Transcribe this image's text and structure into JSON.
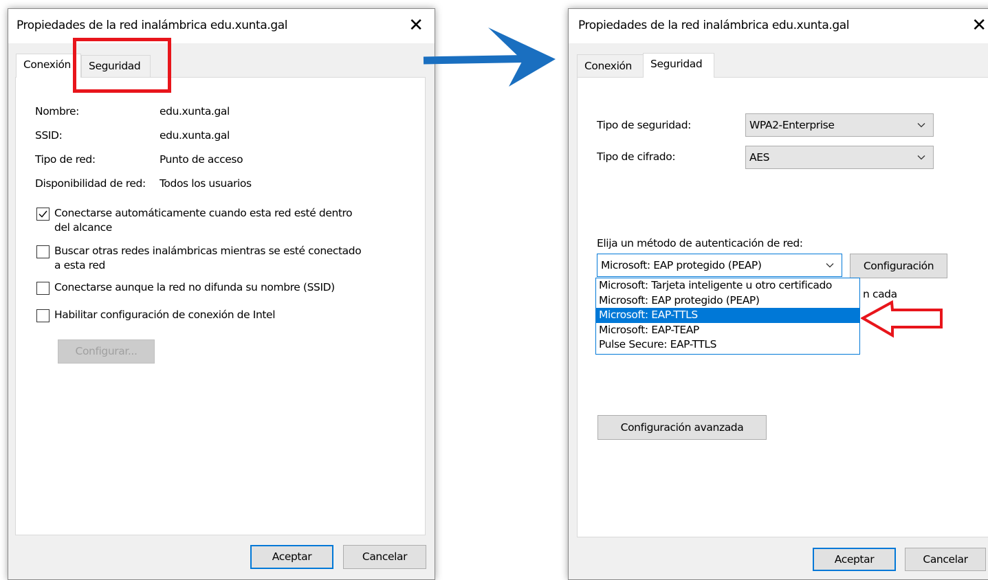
{
  "left_dialog": {
    "title": "Propiedades de la red inalámbrica edu.xunta.gal",
    "close": "✕",
    "tabs": [
      "Conexión",
      "Seguridad"
    ],
    "fields": [
      {
        "label": "Nombre:",
        "value": "edu.xunta.gal"
      },
      {
        "label": "SSID:",
        "value": "edu.xunta.gal"
      },
      {
        "label": "Tipo de red:",
        "value": "Punto de acceso"
      },
      {
        "label": "Disponibilidad de red:",
        "value": "Todos los usuarios"
      }
    ],
    "checkboxes": [
      {
        "line1": "Conectarse automáticamente cuando esta red esté dentro",
        "line2": "del alcance",
        "checked": true
      },
      {
        "line1": "Buscar otras redes inalámbricas mientras se esté conectado",
        "line2": "a esta red",
        "checked": false
      },
      {
        "line1": "Conectarse aunque la red no difunda su nombre (SSID)",
        "line2": "",
        "checked": false
      },
      {
        "line1": "Habilitar configuración de conexión de Intel",
        "line2": "",
        "checked": false
      }
    ],
    "configure_button": "Configurar...",
    "ok_button": "Aceptar",
    "cancel_button": "Cancelar"
  },
  "right_dialog": {
    "title": "Propiedades de la red inalámbrica edu.xunta.gal",
    "close": "✕",
    "tabs": [
      "Conexión",
      "Seguridad"
    ],
    "security_type_label": "Tipo de seguridad:",
    "security_type_value": "WPA2-Enterprise",
    "encryption_label": "Tipo de cifrado:",
    "encryption_value": "AES",
    "auth_label": "Elija un método de autenticación de red:",
    "auth_value": "Microsoft: EAP protegido (PEAP)",
    "config_button": "Configuración",
    "hidden_text_fragment": "n cada",
    "dropdown_options": [
      "Microsoft: Tarjeta inteligente u otro certificado",
      "Microsoft: EAP protegido (PEAP)",
      "Microsoft: EAP-TTLS",
      "Microsoft: EAP-TEAP",
      "Pulse Secure: EAP-TTLS"
    ],
    "selected_option_index": 2,
    "advanced_button": "Configuración avanzada",
    "ok_button": "Aceptar",
    "cancel_button": "Cancelar"
  },
  "annotations": {
    "highlight_color": "#e8151b",
    "arrow_color": "#1a6fc0"
  }
}
